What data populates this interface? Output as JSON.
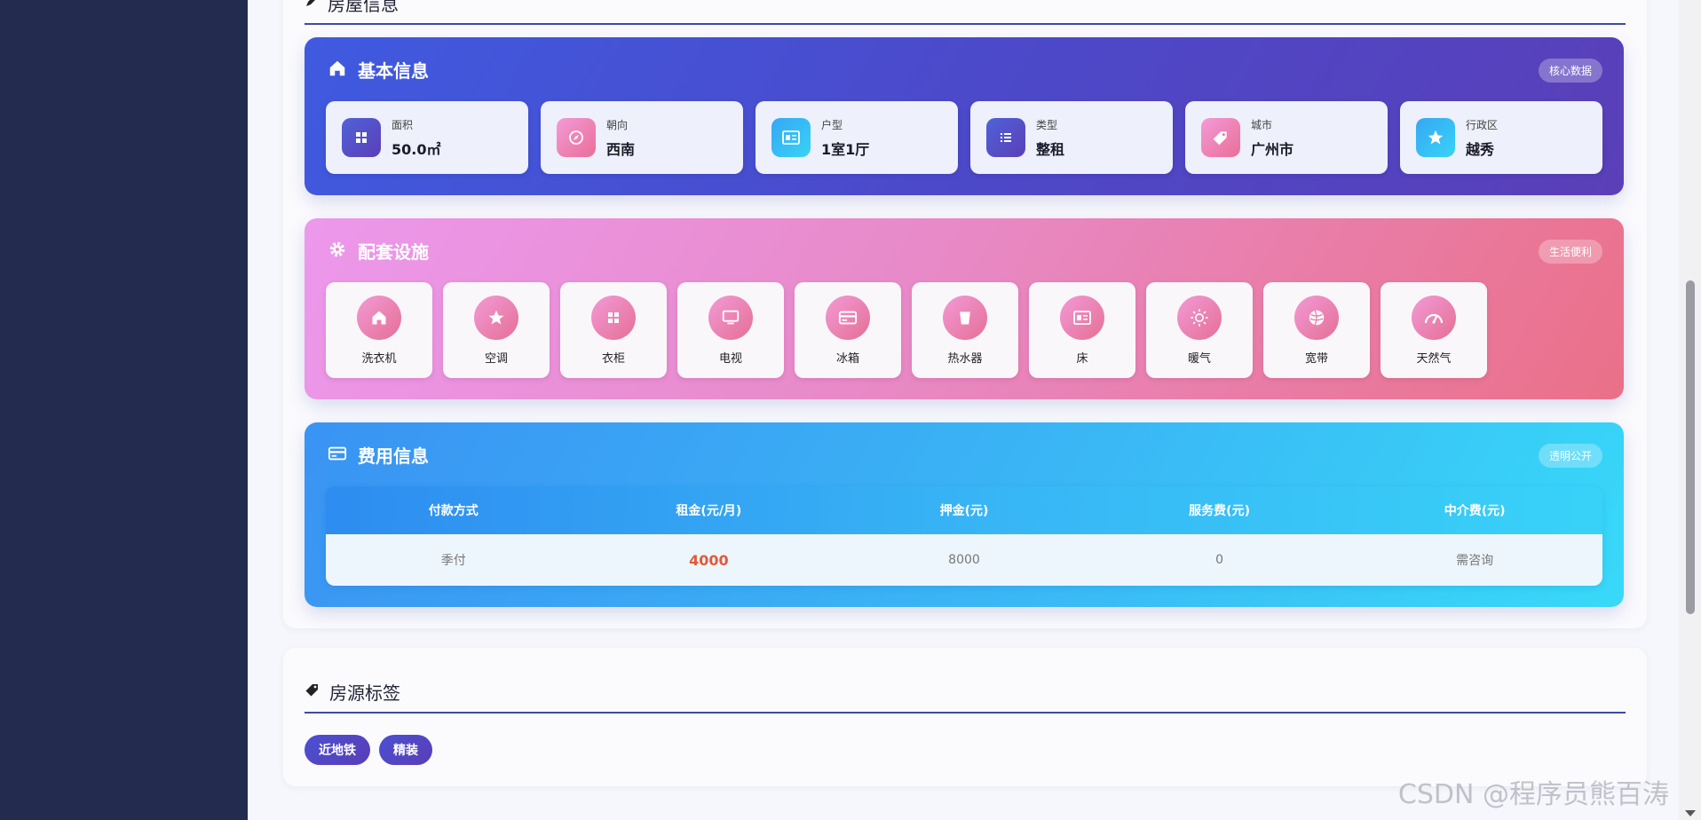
{
  "sections": {
    "property_info_title": "房屋信息",
    "tags_title": "房源标签"
  },
  "basic": {
    "title": "基本信息",
    "badge": "核心数据",
    "items": [
      {
        "label": "面积",
        "value": "50.0㎡",
        "icon": "grid-icon",
        "color": "purple"
      },
      {
        "label": "朝向",
        "value": "西南",
        "icon": "compass-icon",
        "color": "pink"
      },
      {
        "label": "户型",
        "value": "1室1厅",
        "icon": "id-card-icon",
        "color": "cyan"
      },
      {
        "label": "类型",
        "value": "整租",
        "icon": "list-icon",
        "color": "purple"
      },
      {
        "label": "城市",
        "value": "广州市",
        "icon": "tag-icon",
        "color": "pink"
      },
      {
        "label": "行政区",
        "value": "越秀",
        "icon": "star-icon",
        "color": "cyan"
      }
    ]
  },
  "facilities": {
    "title": "配套设施",
    "badge": "生活便利",
    "items": [
      {
        "label": "洗衣机",
        "icon": "home-icon"
      },
      {
        "label": "空调",
        "icon": "star-icon"
      },
      {
        "label": "衣柜",
        "icon": "grid-icon"
      },
      {
        "label": "电视",
        "icon": "tv-icon"
      },
      {
        "label": "冰箱",
        "icon": "credit-card-icon"
      },
      {
        "label": "热水器",
        "icon": "cup-icon"
      },
      {
        "label": "床",
        "icon": "id-card-icon"
      },
      {
        "label": "暖气",
        "icon": "sun-icon"
      },
      {
        "label": "宽带",
        "icon": "globe-icon"
      },
      {
        "label": "天然气",
        "icon": "gauge-icon"
      }
    ]
  },
  "fees": {
    "title": "费用信息",
    "badge": "透明公开",
    "headers": [
      "付款方式",
      "租金(元/月)",
      "押金(元)",
      "服务费(元)",
      "中介费(元)"
    ],
    "values": [
      "季付",
      "4000",
      "8000",
      "0",
      "需咨询"
    ]
  },
  "tags": [
    "近地铁",
    "精装"
  ],
  "watermark": "CSDN @程序员熊百涛",
  "colors": {
    "sidebar": "#232c4f",
    "accent": "#3d4aa3",
    "rent_highlight": "#e05a3a"
  }
}
